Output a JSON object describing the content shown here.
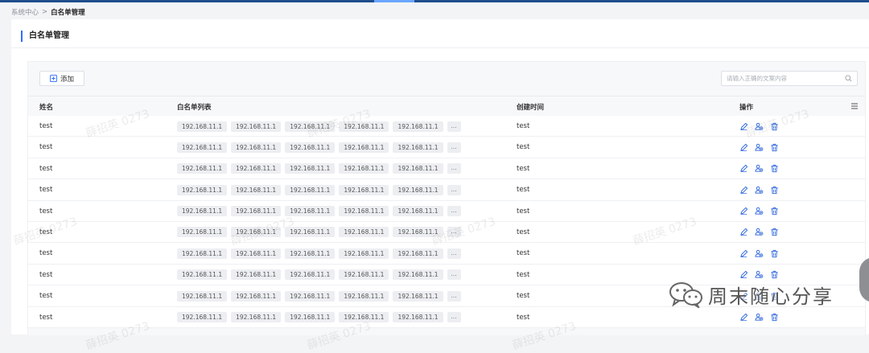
{
  "breadcrumb": {
    "parent": "系统中心",
    "separator": ">",
    "current": "白名单管理"
  },
  "page_title": "白名单管理",
  "toolbar": {
    "add_label": "添加",
    "search_placeholder": "请输入正确的文案内容"
  },
  "table": {
    "columns": {
      "name": "姓名",
      "ips": "白名单列表",
      "time": "创建时间",
      "ops": "操作"
    },
    "rows": [
      {
        "name": "test",
        "ips": [
          "192.168.11.1",
          "192.168.11.1",
          "192.168.11.1",
          "192.168.11.1",
          "192.168.11.1"
        ],
        "more": "...",
        "time": "test"
      },
      {
        "name": "test",
        "ips": [
          "192.168.11.1",
          "192.168.11.1",
          "192.168.11.1",
          "192.168.11.1",
          "192.168.11.1"
        ],
        "more": "...",
        "time": "test"
      },
      {
        "name": "test",
        "ips": [
          "192.168.11.1",
          "192.168.11.1",
          "192.168.11.1",
          "192.168.11.1",
          "192.168.11.1"
        ],
        "more": "...",
        "time": "test"
      },
      {
        "name": "test",
        "ips": [
          "192.168.11.1",
          "192.168.11.1",
          "192.168.11.1",
          "192.168.11.1",
          "192.168.11.1"
        ],
        "more": "...",
        "time": "test"
      },
      {
        "name": "test",
        "ips": [
          "192.168.11.1",
          "192.168.11.1",
          "192.168.11.1",
          "192.168.11.1",
          "192.168.11.1"
        ],
        "more": "...",
        "time": "test"
      },
      {
        "name": "test",
        "ips": [
          "192.168.11.1",
          "192.168.11.1",
          "192.168.11.1",
          "192.168.11.1",
          "192.168.11.1"
        ],
        "more": "...",
        "time": "test"
      },
      {
        "name": "test",
        "ips": [
          "192.168.11.1",
          "192.168.11.1",
          "192.168.11.1",
          "192.168.11.1",
          "192.168.11.1"
        ],
        "more": "...",
        "time": "test"
      },
      {
        "name": "test",
        "ips": [
          "192.168.11.1",
          "192.168.11.1",
          "192.168.11.1",
          "192.168.11.1",
          "192.168.11.1"
        ],
        "more": "...",
        "time": "test"
      },
      {
        "name": "test",
        "ips": [
          "192.168.11.1",
          "192.168.11.1",
          "192.168.11.1",
          "192.168.11.1",
          "192.168.11.1"
        ],
        "more": "...",
        "time": "test"
      },
      {
        "name": "test",
        "ips": [
          "192.168.11.1",
          "192.168.11.1",
          "192.168.11.1",
          "192.168.11.1",
          "192.168.11.1"
        ],
        "more": "...",
        "time": "test"
      }
    ],
    "row_actions": [
      "edit-icon",
      "user-group-icon",
      "delete-icon"
    ]
  },
  "watermark_text": "薛招英 0273",
  "brand_overlay": {
    "text": "周末随心分享",
    "icon": "wechat-logo-icon"
  },
  "colors": {
    "accent": "#2f6bff",
    "action_icon": "#3b6fe0",
    "topbar": "#1f4e8c"
  }
}
